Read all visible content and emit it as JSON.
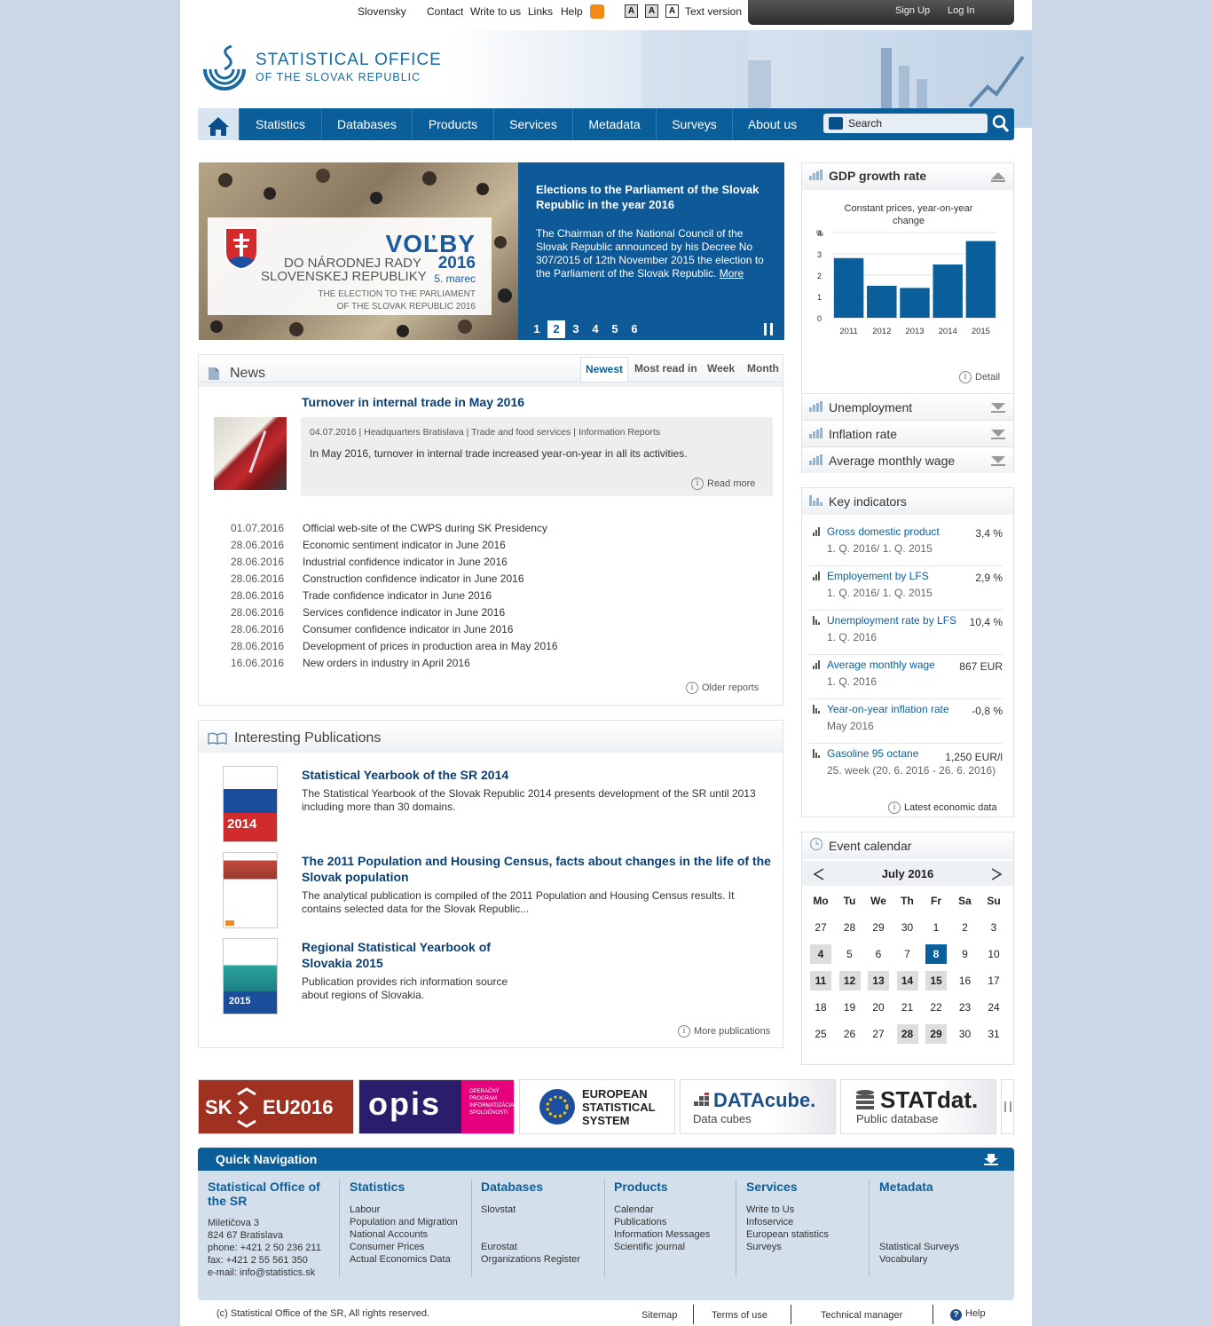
{
  "topbar": {
    "lang": "Slovensky",
    "links": [
      "Contact",
      "Write to us",
      "Links",
      "Help"
    ],
    "text_version": "Text version",
    "sign_up": "Sign Up",
    "log_in": "Log In"
  },
  "header": {
    "logo_line1": "STATISTICAL OFFICE",
    "logo_line2": "OF THE SLOVAK REPUBLIC"
  },
  "nav": {
    "items": [
      "Statistics",
      "Databases",
      "Products",
      "Services",
      "Metadata",
      "Surveys",
      "About us"
    ],
    "search_label": "Search"
  },
  "slider": {
    "volby": "VOĽBY",
    "line1": "DO NÁRODNEJ RADY",
    "year": "2016",
    "line2": "SLOVENSKEJ REPUBLIKY",
    "date": "5. marec",
    "en1": "THE ELECTION TO THE PARLIAMENT",
    "en2": "OF THE SLOVAK REPUBLIC 2016",
    "title": "Elections to the Parliament of the Slovak Republic in the year 2016",
    "text": "The Chairman of the National Council of the Slovak Republic announced by his Decree No 307/2015 of 12th November 2015 the election to the Parliament of the Slovak Republic.",
    "more": "More",
    "pages": [
      "1",
      "2",
      "3",
      "4",
      "5",
      "6"
    ],
    "active_page": "2"
  },
  "news": {
    "title": "News",
    "tabs": [
      "Newest",
      "Most read in",
      "Week",
      "Month"
    ],
    "featured": {
      "title": "Turnover in internal trade in May 2016",
      "meta": "04.07.2016 | Headquarters Bratislava | Trade and food services | Information Reports",
      "text": "In May 2016, turnover in internal trade increased year-on-year in all its activities.",
      "read_more": "Read more"
    },
    "items": [
      {
        "date": "01.07.2016",
        "title": "Official web-site of the CWPS during SK Presidency"
      },
      {
        "date": "28.06.2016",
        "title": "Economic sentiment indicator in June 2016"
      },
      {
        "date": "28.06.2016",
        "title": "Industrial confidence indicator in June 2016"
      },
      {
        "date": "28.06.2016",
        "title": "Construction confidence indicator in June 2016"
      },
      {
        "date": "28.06.2016",
        "title": "Trade confidence indicator in June 2016"
      },
      {
        "date": "28.06.2016",
        "title": "Services confidence indicator in June 2016"
      },
      {
        "date": "28.06.2016",
        "title": "Consumer confidence indicator in June 2016"
      },
      {
        "date": "28.06.2016",
        "title": "Development of prices in production area in May 2016"
      },
      {
        "date": "16.06.2016",
        "title": "New orders in industry in April 2016"
      }
    ],
    "older": "Older reports"
  },
  "publications": {
    "title": "Interesting Publications",
    "items": [
      {
        "title": "Statistical Yearbook of the SR 2014",
        "text": "The Statistical Yearbook of the Slovak Republic 2014 presents development of the SR until 2013 including more than 30 domains.",
        "cover_year": "2014"
      },
      {
        "title": "The 2011 Population and Housing Census, facts about changes in the life of the Slovak population",
        "text": "The analytical publication is compiled of the 2011 Population and Housing Census results. It contains selected data for the Slovak Republic...",
        "cover_year": ""
      },
      {
        "title": "Regional Statistical Yearbook of Slovakia 2015",
        "text": "Publication provides rich information source about regions of Slovakia.",
        "cover_year": "2015"
      }
    ],
    "more": "More publications"
  },
  "gdp": {
    "title": "GDP growth rate",
    "detail": "Detail",
    "chart_data": {
      "type": "bar",
      "title": "Constant prices, year-on-year change",
      "ylabel": "%",
      "categories": [
        "2011",
        "2012",
        "2013",
        "2014",
        "2015"
      ],
      "values": [
        2.8,
        1.5,
        1.4,
        2.5,
        3.6
      ],
      "ylim": [
        0,
        4
      ],
      "yticks": [
        "0",
        "1",
        "2",
        "3",
        "4"
      ],
      "color": "#0a5f9a"
    }
  },
  "indicators_menu": [
    "Unemployment",
    "Inflation rate",
    "Average monthly wage"
  ],
  "key_indicators": {
    "title": "Key indicators",
    "items": [
      {
        "name": "Gross domestic product",
        "period": "1. Q. 2016/ 1. Q. 2015",
        "value": "3,4 %"
      },
      {
        "name": "Employement by LFS",
        "period": "1. Q. 2016/ 1. Q. 2015",
        "value": "2,9 %"
      },
      {
        "name": "Unemployment rate by LFS",
        "period": "1. Q. 2016",
        "value": "10,4 %"
      },
      {
        "name": "Average monthly wage",
        "period": "1. Q. 2016",
        "value": "867 EUR"
      },
      {
        "name": "Year-on-year inflation rate",
        "period": "May 2016",
        "value": "-0,8 %"
      },
      {
        "name": "Gasoline 95 octane",
        "period": "25. week (20. 6. 2016 - 26. 6. 2016)",
        "value": "1,250 EUR/l"
      }
    ],
    "latest": "Latest economic data"
  },
  "calendar": {
    "title": "Event calendar",
    "month": "July 2016",
    "days": [
      "Mo",
      "Tu",
      "We",
      "Th",
      "Fr",
      "Sa",
      "Su"
    ],
    "weeks": [
      [
        "27",
        "28",
        "29",
        "30",
        "1",
        "2",
        "3"
      ],
      [
        "4",
        "5",
        "6",
        "7",
        "8",
        "9",
        "10"
      ],
      [
        "11",
        "12",
        "13",
        "14",
        "15",
        "16",
        "17"
      ],
      [
        "18",
        "19",
        "20",
        "21",
        "22",
        "23",
        "24"
      ],
      [
        "25",
        "26",
        "27",
        "28",
        "29",
        "30",
        "31"
      ]
    ],
    "event_days": [
      "4",
      "11",
      "12",
      "13",
      "14",
      "15",
      "28",
      "29"
    ],
    "selected_day": "8"
  },
  "banners": {
    "sk_left": "SK",
    "sk_right": "EU2016",
    "opis": "opis",
    "opis_sub": "OPERAČNÝ PROGRAM INFORMATIZÁCIA SPOLOČNOSTI",
    "ess": "EUROPEAN STATISTICAL SYSTEM",
    "datacube": "DATAcube.",
    "datacube_sub": "Data cubes",
    "statdat": "STATdat.",
    "statdat_sub": "Public database"
  },
  "quicknav": {
    "title": "Quick Navigation",
    "office": {
      "title": "Statistical Office of the SR",
      "lines": [
        "Miletičova 3",
        "824 67 Bratislava",
        "phone: +421 2 50 236 211",
        "fax: +421 2 55 561 350",
        "e-mail: info@statistics.sk"
      ]
    },
    "columns": [
      {
        "title": "Statistics",
        "links": [
          "Labour",
          "Population and Migration",
          "National Accounts",
          "Consumer Prices",
          "Actual Economics Data"
        ]
      },
      {
        "title": "Databases",
        "links": [
          "Slovstat",
          "",
          "",
          "Eurostat",
          "Organizations Register"
        ]
      },
      {
        "title": "Products",
        "links": [
          "Calendar",
          "Publications",
          "Information Messages",
          "Scientific journal"
        ]
      },
      {
        "title": "Services",
        "links": [
          "Write to Us",
          "Infoservice",
          "European statistics",
          "Surveys"
        ]
      },
      {
        "title": "Metadata",
        "links": [
          "",
          "",
          "",
          "Statistical Surveys",
          "Vocabulary"
        ]
      }
    ]
  },
  "footer": {
    "copyright": "(c) Statistical Office of the SR, All rights reserved.",
    "links": [
      "Sitemap",
      "Terms of use",
      "Technical manager",
      "Help"
    ]
  }
}
